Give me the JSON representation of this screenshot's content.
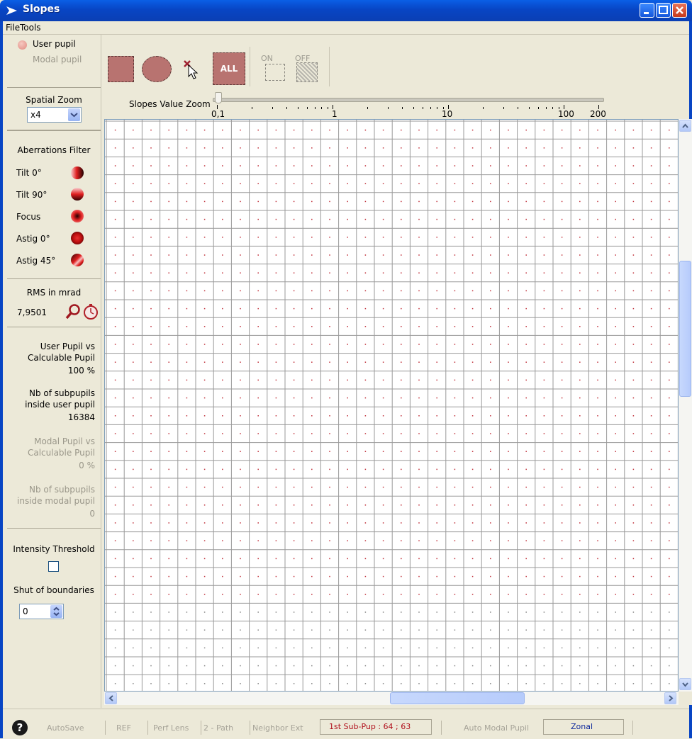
{
  "window": {
    "title": "Slopes"
  },
  "menu": {
    "file": "File",
    "tools": "Tools"
  },
  "pupil": {
    "user_pupil": "User pupil",
    "modal_pupil": "Modal pupil"
  },
  "spatial_zoom": {
    "label": "Spatial Zoom",
    "value": "x4"
  },
  "toolbar": {
    "all_label": "ALL",
    "on_label": "ON",
    "off_label": "OFF"
  },
  "slopes_zoom": {
    "label": "Slopes Value Zoom",
    "ticks": [
      "0,1",
      "1",
      "10",
      "100",
      "200"
    ]
  },
  "aberrations": {
    "heading": "Aberrations Filter",
    "items": [
      {
        "label": "Tilt 0°",
        "icon": "tilt-0-icon"
      },
      {
        "label": "Tilt 90°",
        "icon": "tilt-90-icon"
      },
      {
        "label": "Focus",
        "icon": "focus-icon"
      },
      {
        "label": "Astig 0°",
        "icon": "astig-0-icon"
      },
      {
        "label": "Astig 45°",
        "icon": "astig-45-icon"
      }
    ]
  },
  "rms": {
    "heading": "RMS in mrad",
    "value": "7,9501"
  },
  "stats": {
    "user_vs_calc_line1": "User Pupil vs",
    "user_vs_calc_line2": "Calculable Pupil",
    "user_vs_calc_value": "100 %",
    "nb_user_line1": "Nb of subpupils",
    "nb_user_line2": "inside user pupil",
    "nb_user_value": "16384",
    "modal_vs_calc_line1": "Modal Pupil vs",
    "modal_vs_calc_line2": "Calculable Pupil",
    "modal_vs_calc_value": "0 %",
    "nb_modal_line1": "Nb of subpupils",
    "nb_modal_line2": "inside modal pupil",
    "nb_modal_value": "0"
  },
  "threshold": {
    "label": "Intensity Threshold"
  },
  "boundaries": {
    "label": "Shut of boundaries",
    "value": "0"
  },
  "statusbar": {
    "autosave": "AutoSave",
    "ref": "REF",
    "perf_lens": "Perf Lens",
    "two_path": "2 - Path",
    "neighbor_ext": "Neighbor Ext",
    "sub_pup": "1st Sub-Pup : 64 ; 63",
    "auto_modal": "Auto Modal Pupil",
    "zonal": "Zonal"
  },
  "colors": {
    "accent": "#b87370",
    "grid_line": "#9a9a9a",
    "dot": "#c0303a"
  }
}
